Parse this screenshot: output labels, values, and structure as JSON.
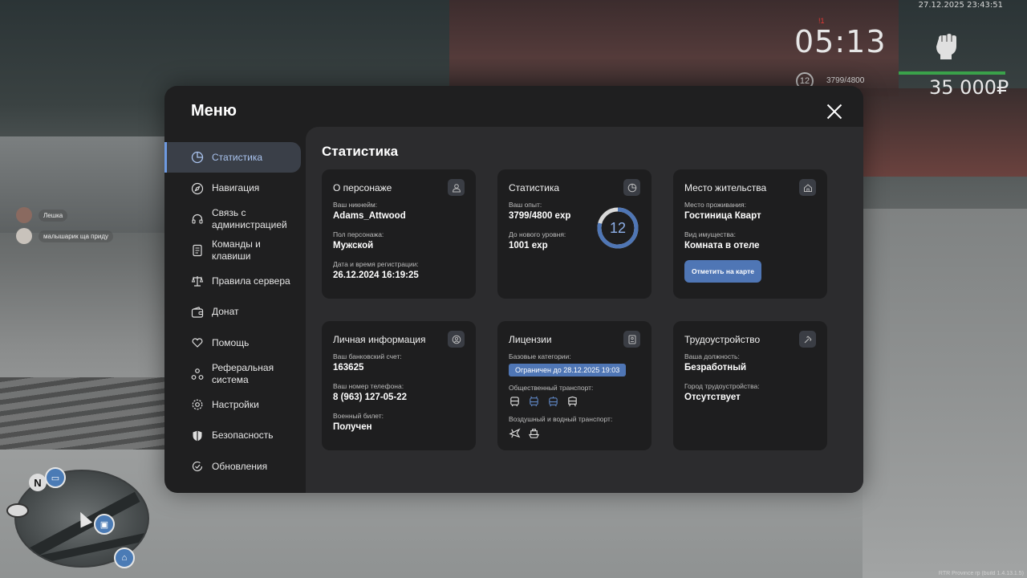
{
  "hud": {
    "datetime": "27.12.2025 23:43:51",
    "clock": "05:13",
    "clock_mark": "!1",
    "level": "12",
    "exp": "3799/4800",
    "money": "35 000₽",
    "version": "RTR Province rp (build 1.4.13.1.5)"
  },
  "chat": [
    {
      "name": "Лешка"
    },
    {
      "name": "малышарик ща приду"
    }
  ],
  "menu": {
    "title": "Меню",
    "sidebar": [
      {
        "label": "Статистика",
        "icon": "statistics-icon",
        "active": true
      },
      {
        "label": "Навигация",
        "icon": "compass-icon"
      },
      {
        "label": "Связь с администрацией",
        "icon": "headset-icon"
      },
      {
        "label": "Команды и клавиши",
        "icon": "document-icon"
      },
      {
        "label": "Правила сервера",
        "icon": "scales-icon"
      },
      {
        "label": "Донат",
        "icon": "wallet-icon"
      },
      {
        "label": "Помощь",
        "icon": "heart-hand-icon"
      },
      {
        "label": "Реферальная система",
        "icon": "referral-icon"
      },
      {
        "label": "Настройки",
        "icon": "gear-icon"
      },
      {
        "label": "Безопасность",
        "icon": "shield-icon"
      },
      {
        "label": "Обновления",
        "icon": "update-icon"
      }
    ],
    "content_title": "Статистика",
    "cards": {
      "character": {
        "title": "О персонаже",
        "nickname_label": "Ваш никнейм:",
        "nickname": "Adams_Attwood",
        "gender_label": "Пол персонажа:",
        "gender": "Мужской",
        "reg_label": "Дата и время регистрации:",
        "reg": "26.12.2024 16:19:25"
      },
      "stats": {
        "title": "Статистика",
        "exp_label": "Ваш опыт:",
        "exp": "3799/4800 exp",
        "next_label": "До нового уровня:",
        "next": "1001 exp",
        "level": "12",
        "progress": 0.79
      },
      "residence": {
        "title": "Место жительства",
        "place_label": "Место проживания:",
        "place": "Гостиница Кварт",
        "property_label": "Вид имущества:",
        "property": "Комната в отеле",
        "button": "Отметить на карте"
      },
      "personal": {
        "title": "Личная информация",
        "bank_label": "Ваш банковский счет:",
        "bank": "163625",
        "phone_label": "Ваш номер телефона:",
        "phone": "8 (963) 127-05-22",
        "military_label": "Военный билет:",
        "military": "Получен"
      },
      "licenses": {
        "title": "Лицензии",
        "base_label": "Базовые категории:",
        "base_status": "Ограничен до 28.12.2025 19:03",
        "public_label": "Общественный транспорт:",
        "air_label": "Воздушный и водный транспорт:"
      },
      "job": {
        "title": "Трудоустройство",
        "position_label": "Ваша должность:",
        "position": "Безработный",
        "city_label": "Город трудоустройства:",
        "city": "Отсутствует"
      }
    }
  },
  "colors": {
    "accent": "#4f76b5",
    "active_nav_bg": "#3a3f48",
    "health": "#3aa24a"
  }
}
